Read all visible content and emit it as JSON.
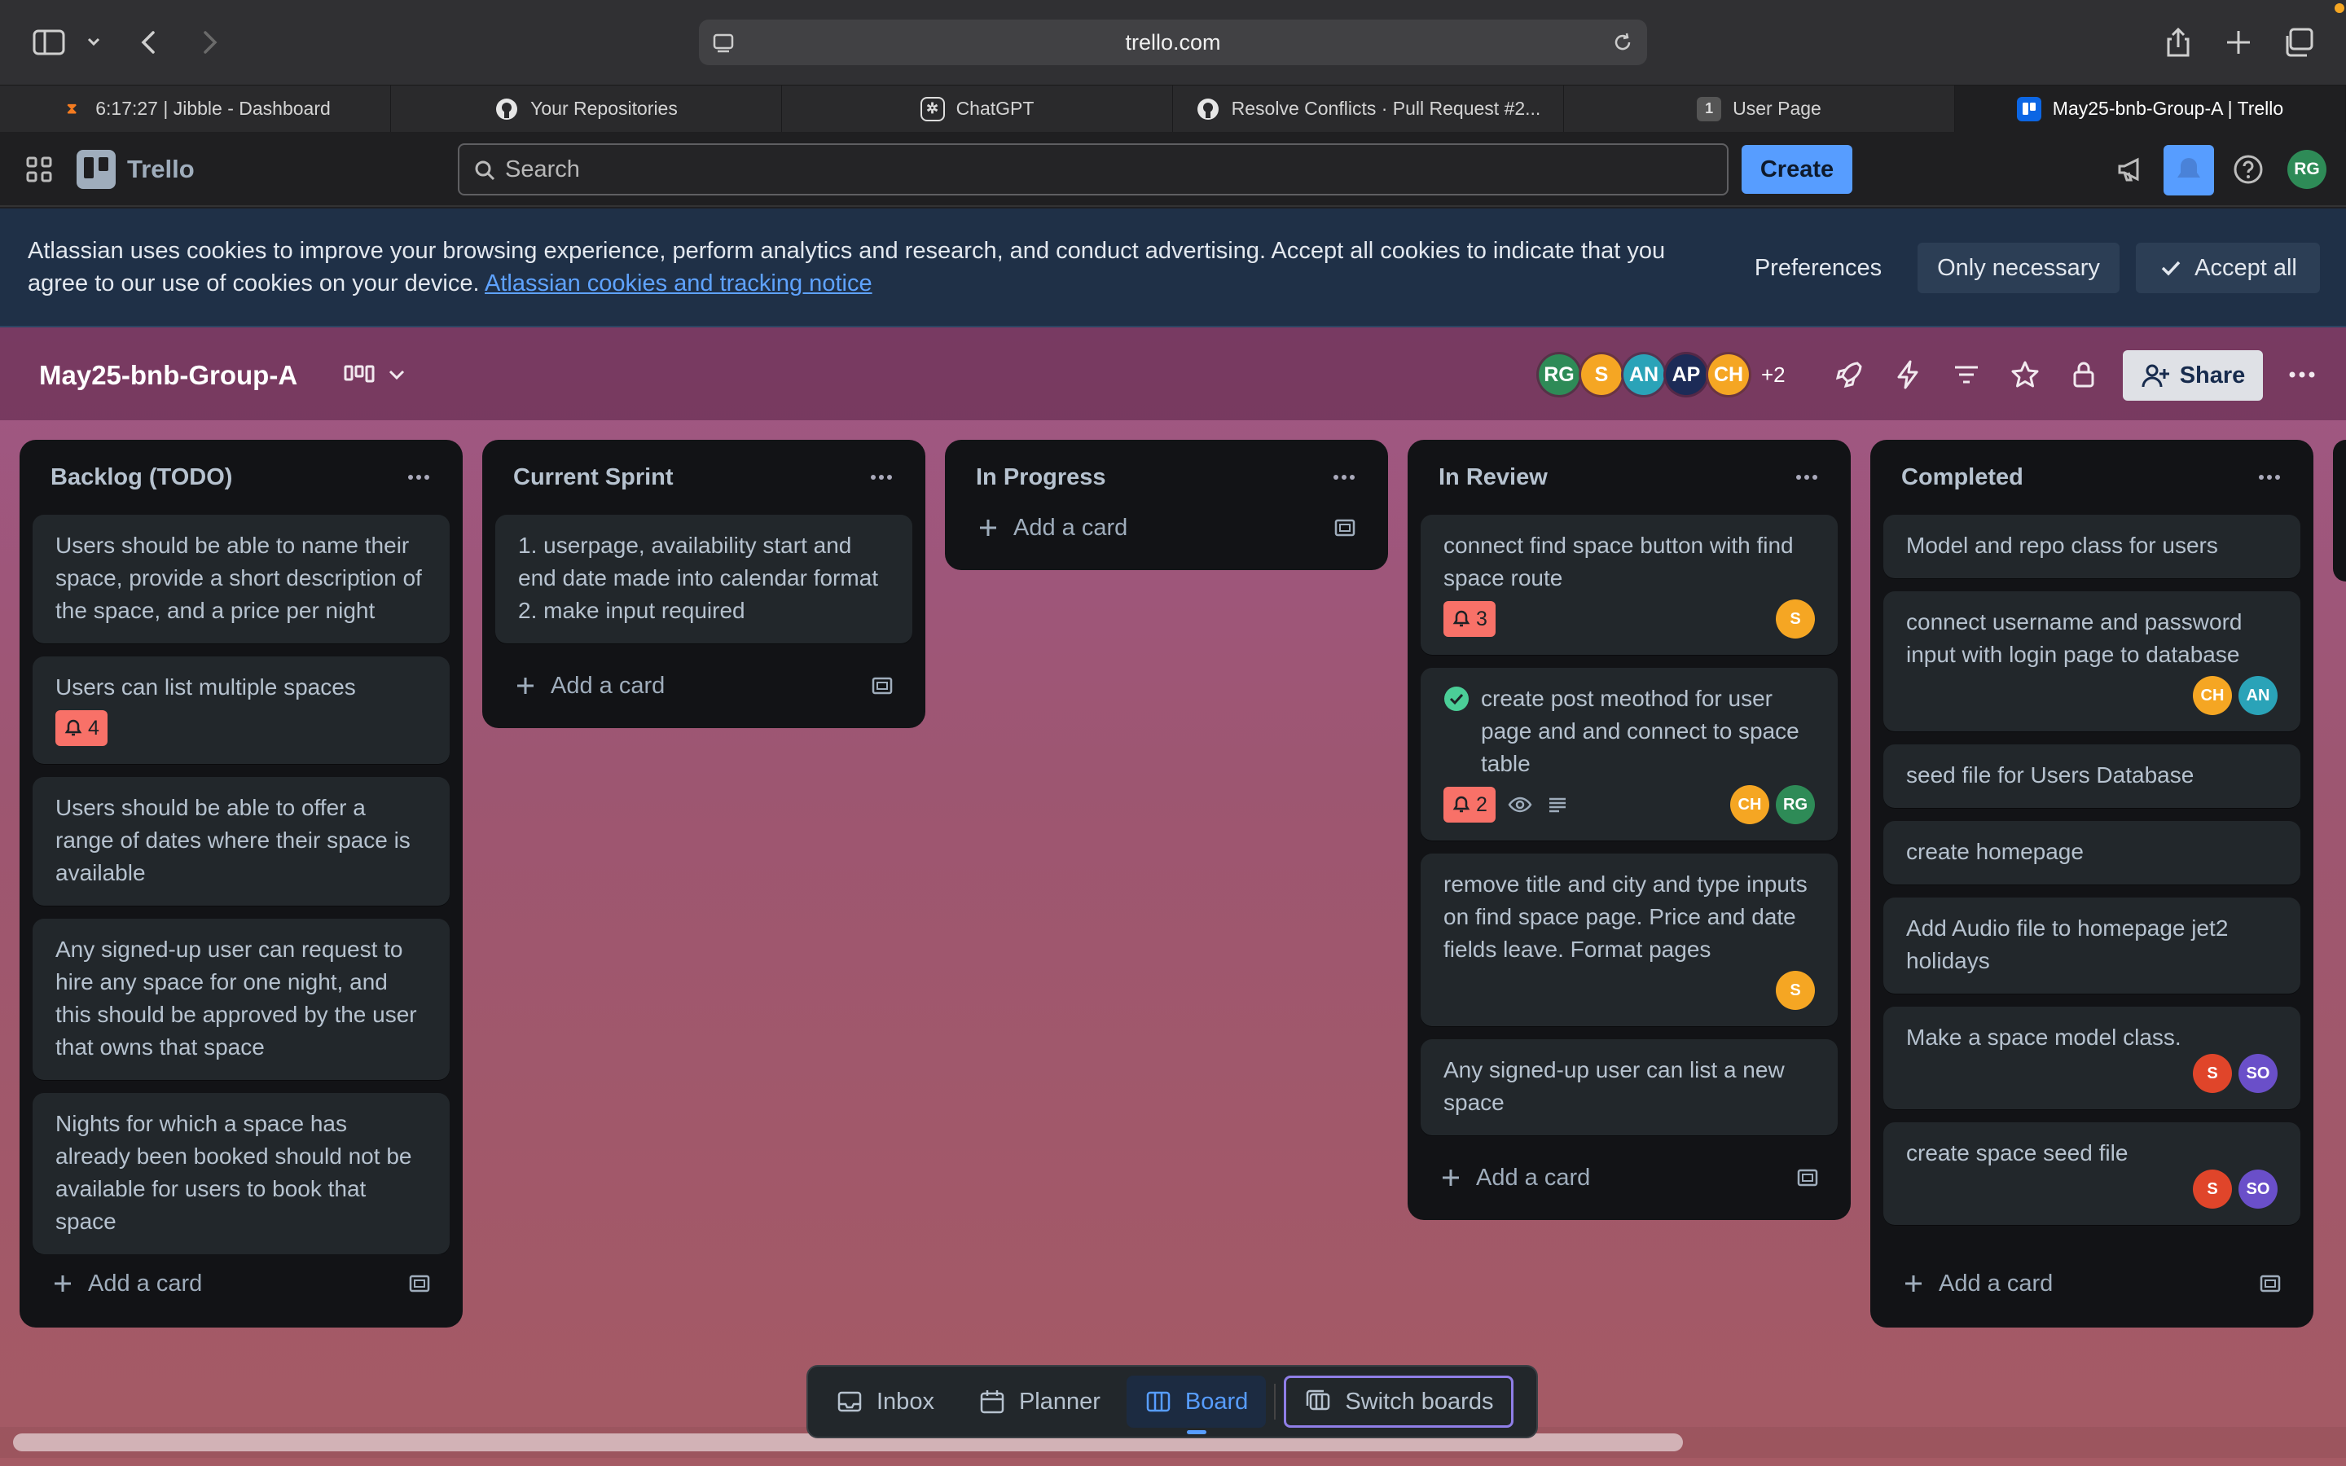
{
  "browser": {
    "url": "trello.com",
    "tabs": [
      {
        "label": "6:17:27 | Jibble - Dashboard",
        "icon": "jibble-icon"
      },
      {
        "label": "Your Repositories",
        "icon": "github-icon"
      },
      {
        "label": "ChatGPT",
        "icon": "chatgpt-icon"
      },
      {
        "label": "Resolve Conflicts · Pull Request #2...",
        "icon": "github-icon"
      },
      {
        "label": "User Page",
        "icon": "page-icon",
        "badge": "1"
      },
      {
        "label": "May25-bnb-Group-A | Trello",
        "icon": "trello-icon",
        "active": true
      }
    ]
  },
  "header": {
    "logo_text": "Trello",
    "search_placeholder": "Search",
    "create_label": "Create",
    "user_initials": "RG"
  },
  "cookie_banner": {
    "message": "Atlassian uses cookies to improve your browsing experience, perform analytics and research, and conduct advertising. Accept all cookies to indicate that you agree to our use of cookies on your device.",
    "link_text": "Atlassian cookies and tracking notice",
    "preferences_label": "Preferences",
    "only_necessary_label": "Only necessary",
    "accept_all_label": "Accept all"
  },
  "board": {
    "title": "May25-bnb-Group-A",
    "members": [
      {
        "initials": "RG",
        "color": "#2e8b57"
      },
      {
        "initials": "S",
        "color": "#f5a623"
      },
      {
        "initials": "AN",
        "color": "#2aa3b8"
      },
      {
        "initials": "AP",
        "color": "#1c2b57"
      },
      {
        "initials": "CH",
        "color": "#f5a623"
      }
    ],
    "more_members": "+2",
    "share_label": "Share"
  },
  "lists": [
    {
      "title": "Backlog (TODO)",
      "cards": [
        {
          "text": "Users should be able to name their space, provide a short description of the space, and a price per night"
        },
        {
          "text": "Users can list multiple spaces",
          "notifications": "4"
        },
        {
          "text": "Users should be able to offer a range of dates where their space is available"
        },
        {
          "text": "Any signed-up user can request to hire any space for one night, and this should be approved by the user that owns that space"
        },
        {
          "text": "Nights for which a space has already been booked should not be available for users to book that space"
        }
      ],
      "add_label": "Add a card"
    },
    {
      "title": "Current Sprint",
      "cards": [
        {
          "text": "1. userpage, availability start and end date made into calendar format 2. make input required"
        }
      ],
      "add_label": "Add a card"
    },
    {
      "title": "In Progress",
      "cards": [],
      "add_label": "Add a card"
    },
    {
      "title": "In Review",
      "cards": [
        {
          "text": "connect find space button with find space route",
          "notifications": "3",
          "members": [
            {
              "initials": "S",
              "color": "#f5a623"
            }
          ]
        },
        {
          "text": "create post meothod for user page and and connect to space table",
          "complete": true,
          "notifications": "2",
          "watch": true,
          "description": true,
          "members": [
            {
              "initials": "CH",
              "color": "#f5a623"
            },
            {
              "initials": "RG",
              "color": "#2e8b57"
            }
          ]
        },
        {
          "text": "remove title and city and type inputs on find space page. Price and date fields leave. Format pages",
          "members": [
            {
              "initials": "S",
              "color": "#f5a623"
            }
          ]
        },
        {
          "text": "Any signed-up user can list a new space"
        }
      ],
      "add_label": "Add a card"
    },
    {
      "title": "Completed",
      "cards": [
        {
          "text": "Model and repo class for users"
        },
        {
          "text": "connect username and password input with login page to database",
          "members": [
            {
              "initials": "CH",
              "color": "#f5a623"
            },
            {
              "initials": "AN",
              "color": "#2aa3b8"
            }
          ]
        },
        {
          "text": "seed file for Users Database"
        },
        {
          "text": "create homepage"
        },
        {
          "text": "Add Audio file to homepage jet2 holidays"
        },
        {
          "text": "Make a space model class.",
          "members": [
            {
              "initials": "S",
              "color": "#e0452a"
            },
            {
              "initials": "SO",
              "color": "#6a4fc9"
            }
          ]
        },
        {
          "text": "create space seed file",
          "members": [
            {
              "initials": "S",
              "color": "#e0452a"
            },
            {
              "initials": "SO",
              "color": "#6a4fc9"
            }
          ]
        }
      ],
      "add_label": "Add a card"
    }
  ],
  "bottom_nav": {
    "inbox": "Inbox",
    "planner": "Planner",
    "board": "Board",
    "switch": "Switch boards"
  }
}
